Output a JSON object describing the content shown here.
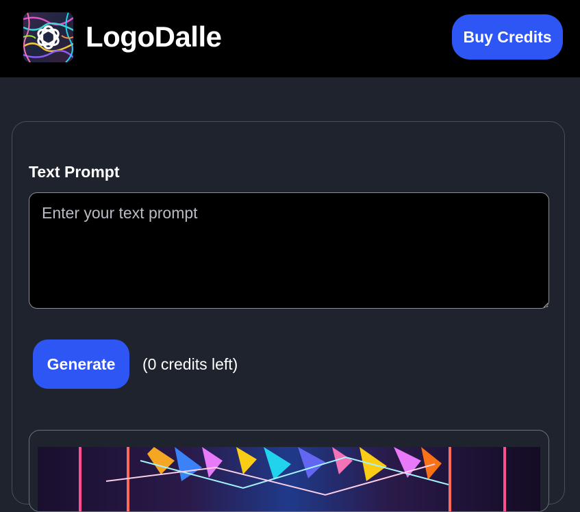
{
  "header": {
    "logo_icon": "openai-swirl-logo-icon",
    "app_title": "LogoDalle",
    "buy_credits_label": "Buy Credits"
  },
  "form": {
    "prompt_label": "Text Prompt",
    "prompt_placeholder": "Enter your text prompt",
    "prompt_value": "",
    "generate_label": "Generate",
    "credits_text": "(0 credits left)"
  },
  "colors": {
    "header_bg": "#000000",
    "page_bg": "#1f232d",
    "accent_blue": "#2e56f5",
    "card_border": "#4a4f5a"
  }
}
